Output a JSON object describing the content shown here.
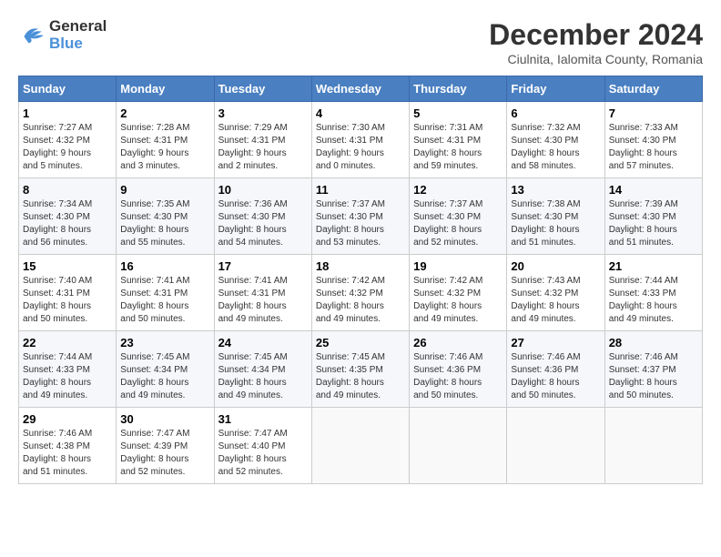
{
  "header": {
    "logo_line1": "General",
    "logo_line2": "Blue",
    "title": "December 2024",
    "subtitle": "Ciulnita, Ialomita County, Romania"
  },
  "calendar": {
    "columns": [
      "Sunday",
      "Monday",
      "Tuesday",
      "Wednesday",
      "Thursday",
      "Friday",
      "Saturday"
    ],
    "weeks": [
      [
        {
          "day": "1",
          "info": "Sunrise: 7:27 AM\nSunset: 4:32 PM\nDaylight: 9 hours\nand 5 minutes."
        },
        {
          "day": "2",
          "info": "Sunrise: 7:28 AM\nSunset: 4:31 PM\nDaylight: 9 hours\nand 3 minutes."
        },
        {
          "day": "3",
          "info": "Sunrise: 7:29 AM\nSunset: 4:31 PM\nDaylight: 9 hours\nand 2 minutes."
        },
        {
          "day": "4",
          "info": "Sunrise: 7:30 AM\nSunset: 4:31 PM\nDaylight: 9 hours\nand 0 minutes."
        },
        {
          "day": "5",
          "info": "Sunrise: 7:31 AM\nSunset: 4:31 PM\nDaylight: 8 hours\nand 59 minutes."
        },
        {
          "day": "6",
          "info": "Sunrise: 7:32 AM\nSunset: 4:30 PM\nDaylight: 8 hours\nand 58 minutes."
        },
        {
          "day": "7",
          "info": "Sunrise: 7:33 AM\nSunset: 4:30 PM\nDaylight: 8 hours\nand 57 minutes."
        }
      ],
      [
        {
          "day": "8",
          "info": "Sunrise: 7:34 AM\nSunset: 4:30 PM\nDaylight: 8 hours\nand 56 minutes."
        },
        {
          "day": "9",
          "info": "Sunrise: 7:35 AM\nSunset: 4:30 PM\nDaylight: 8 hours\nand 55 minutes."
        },
        {
          "day": "10",
          "info": "Sunrise: 7:36 AM\nSunset: 4:30 PM\nDaylight: 8 hours\nand 54 minutes."
        },
        {
          "day": "11",
          "info": "Sunrise: 7:37 AM\nSunset: 4:30 PM\nDaylight: 8 hours\nand 53 minutes."
        },
        {
          "day": "12",
          "info": "Sunrise: 7:37 AM\nSunset: 4:30 PM\nDaylight: 8 hours\nand 52 minutes."
        },
        {
          "day": "13",
          "info": "Sunrise: 7:38 AM\nSunset: 4:30 PM\nDaylight: 8 hours\nand 51 minutes."
        },
        {
          "day": "14",
          "info": "Sunrise: 7:39 AM\nSunset: 4:30 PM\nDaylight: 8 hours\nand 51 minutes."
        }
      ],
      [
        {
          "day": "15",
          "info": "Sunrise: 7:40 AM\nSunset: 4:31 PM\nDaylight: 8 hours\nand 50 minutes."
        },
        {
          "day": "16",
          "info": "Sunrise: 7:41 AM\nSunset: 4:31 PM\nDaylight: 8 hours\nand 50 minutes."
        },
        {
          "day": "17",
          "info": "Sunrise: 7:41 AM\nSunset: 4:31 PM\nDaylight: 8 hours\nand 49 minutes."
        },
        {
          "day": "18",
          "info": "Sunrise: 7:42 AM\nSunset: 4:32 PM\nDaylight: 8 hours\nand 49 minutes."
        },
        {
          "day": "19",
          "info": "Sunrise: 7:42 AM\nSunset: 4:32 PM\nDaylight: 8 hours\nand 49 minutes."
        },
        {
          "day": "20",
          "info": "Sunrise: 7:43 AM\nSunset: 4:32 PM\nDaylight: 8 hours\nand 49 minutes."
        },
        {
          "day": "21",
          "info": "Sunrise: 7:44 AM\nSunset: 4:33 PM\nDaylight: 8 hours\nand 49 minutes."
        }
      ],
      [
        {
          "day": "22",
          "info": "Sunrise: 7:44 AM\nSunset: 4:33 PM\nDaylight: 8 hours\nand 49 minutes."
        },
        {
          "day": "23",
          "info": "Sunrise: 7:45 AM\nSunset: 4:34 PM\nDaylight: 8 hours\nand 49 minutes."
        },
        {
          "day": "24",
          "info": "Sunrise: 7:45 AM\nSunset: 4:34 PM\nDaylight: 8 hours\nand 49 minutes."
        },
        {
          "day": "25",
          "info": "Sunrise: 7:45 AM\nSunset: 4:35 PM\nDaylight: 8 hours\nand 49 minutes."
        },
        {
          "day": "26",
          "info": "Sunrise: 7:46 AM\nSunset: 4:36 PM\nDaylight: 8 hours\nand 50 minutes."
        },
        {
          "day": "27",
          "info": "Sunrise: 7:46 AM\nSunset: 4:36 PM\nDaylight: 8 hours\nand 50 minutes."
        },
        {
          "day": "28",
          "info": "Sunrise: 7:46 AM\nSunset: 4:37 PM\nDaylight: 8 hours\nand 50 minutes."
        }
      ],
      [
        {
          "day": "29",
          "info": "Sunrise: 7:46 AM\nSunset: 4:38 PM\nDaylight: 8 hours\nand 51 minutes."
        },
        {
          "day": "30",
          "info": "Sunrise: 7:47 AM\nSunset: 4:39 PM\nDaylight: 8 hours\nand 52 minutes."
        },
        {
          "day": "31",
          "info": "Sunrise: 7:47 AM\nSunset: 4:40 PM\nDaylight: 8 hours\nand 52 minutes."
        },
        {
          "day": "",
          "info": ""
        },
        {
          "day": "",
          "info": ""
        },
        {
          "day": "",
          "info": ""
        },
        {
          "day": "",
          "info": ""
        }
      ]
    ]
  }
}
